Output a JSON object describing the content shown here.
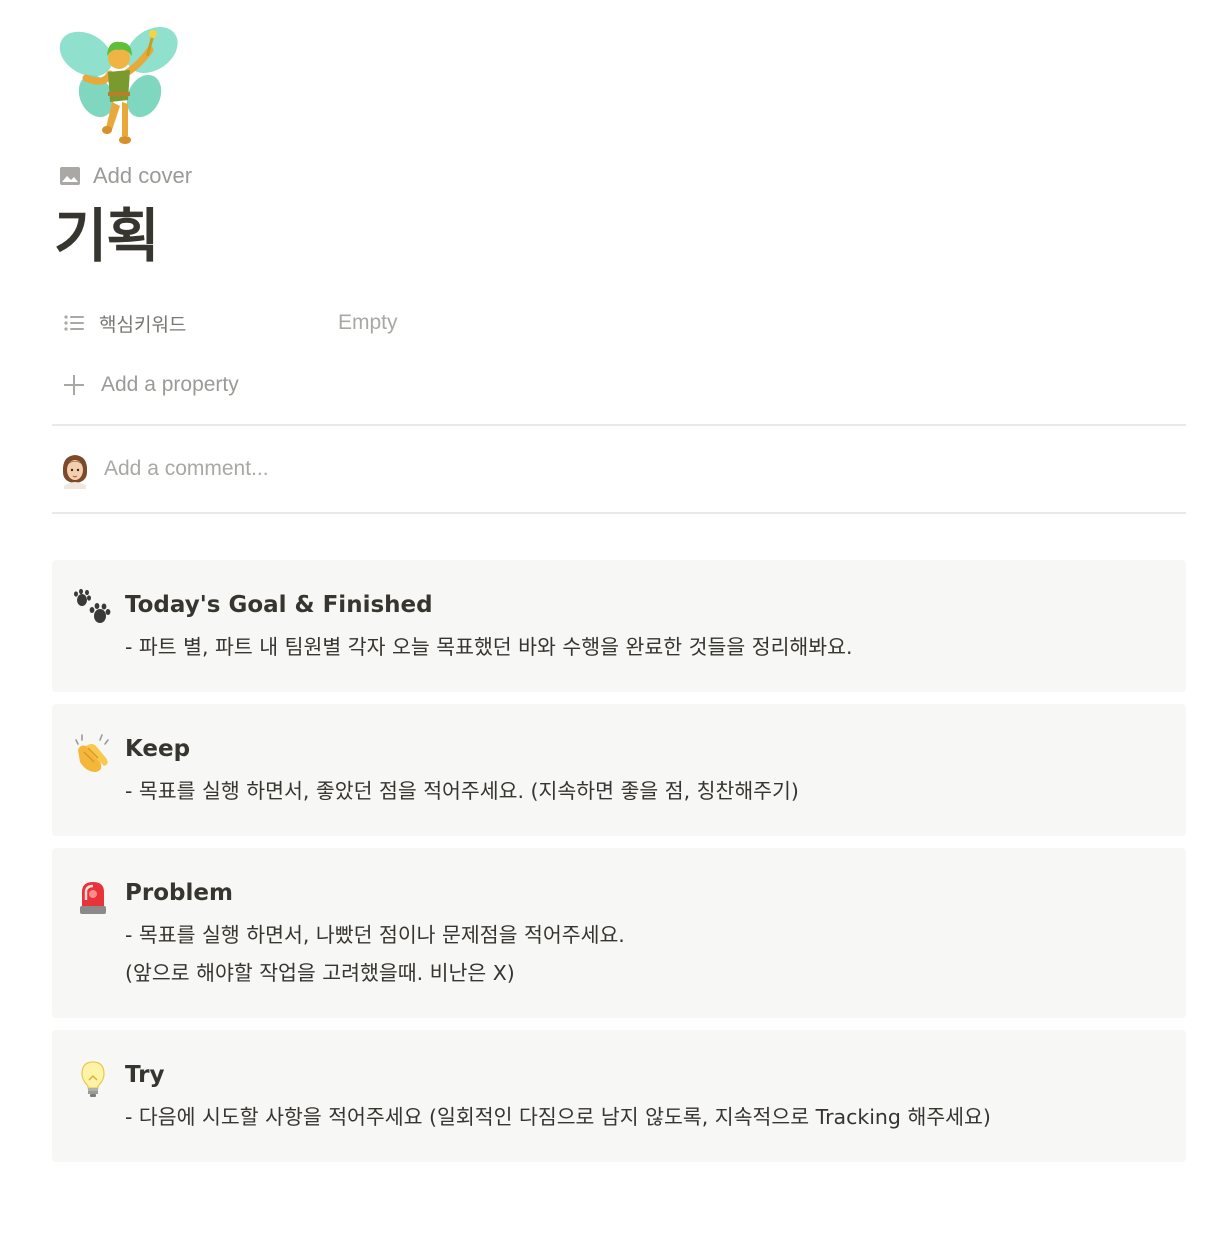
{
  "page": {
    "icon": "fairy-emoji-icon",
    "add_cover_label": "Add cover",
    "title": "기획"
  },
  "properties": {
    "items": [
      {
        "icon": "list-icon",
        "name": "핵심키워드",
        "value": "Empty"
      }
    ],
    "add_property_label": "Add a property"
  },
  "comment": {
    "avatar": "user-avatar",
    "placeholder": "Add a comment..."
  },
  "callouts": [
    {
      "icon": "paw-prints-icon",
      "title": "Today's Goal & Finished",
      "lines": [
        "- 파트 별, 파트 내 팀원별 각자 오늘 목표했던 바와 수행을 완료한 것들을 정리해봐요."
      ]
    },
    {
      "icon": "clapping-hands-icon",
      "title": "Keep",
      "lines": [
        "- 목표를 실행 하면서, 좋았던 점을 적어주세요. (지속하면 좋을 점, 칭찬해주기)"
      ]
    },
    {
      "icon": "police-light-icon",
      "title": "Problem",
      "lines": [
        "- 목표를 실행 하면서, 나빴던 점이나 문제점을 적어주세요.",
        "(앞으로 해야할 작업을 고려했을때. 비난은 X)"
      ]
    },
    {
      "icon": "light-bulb-icon",
      "title": "Try",
      "lines": [
        "- 다음에 시도할 사항을 적어주세요 (일회적인 다짐으로 남지 않도록, 지속적으로 Tracking 해주세요)"
      ]
    }
  ],
  "colors": {
    "text": "#37352f",
    "muted": "#9b9a97",
    "callout_bg": "#f7f7f5",
    "divider": "#e9e9e7"
  }
}
